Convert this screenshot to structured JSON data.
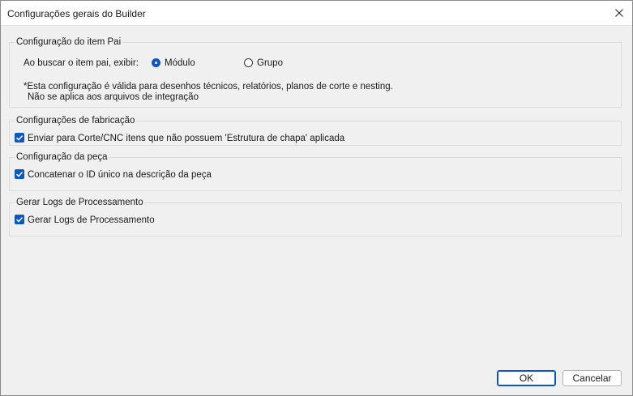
{
  "window": {
    "title": "Configurações gerais do Builder"
  },
  "parent_item": {
    "group_label": "Configuração do item Pai",
    "search_label": "Ao buscar o item pai, exibir:",
    "options": [
      {
        "label": "Módulo",
        "selected": true
      },
      {
        "label": "Grupo",
        "selected": false
      }
    ],
    "note_line1": "*Esta configuração é válida para desenhos técnicos, relatórios, planos de corte e nesting.",
    "note_line2": "Não se aplica aos arquivos de integração"
  },
  "fabrication": {
    "group_label": "Configurações de fabricação",
    "checkbox_label": "Enviar para Corte/CNC itens que não possuem 'Estrutura de chapa' aplicada",
    "checked": true
  },
  "part": {
    "group_label": "Configuração da peça",
    "checkbox_label": "Concatenar o ID único na descrição da peça",
    "checked": true
  },
  "logs": {
    "group_label": "Gerar Logs de Processamento",
    "checkbox_label": "Gerar Logs de Processamento",
    "checked": true
  },
  "buttons": {
    "ok_label": "OK",
    "cancel_label": "Cancelar"
  },
  "colors": {
    "accent": "#0a57c2",
    "background": "#f0f0f0"
  }
}
